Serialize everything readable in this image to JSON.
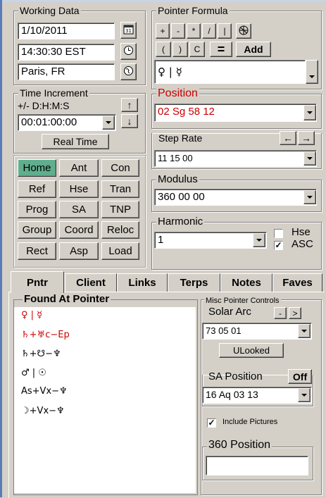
{
  "working_data": {
    "title": "Working Data",
    "date": "1/10/2011",
    "time": "14:30:30  EST",
    "place": "Paris, FR"
  },
  "time_increment": {
    "title": "Time Increment",
    "format_label": "+/- D:H:M:S",
    "value": "00:01:00:00",
    "real_time_label": "Real Time"
  },
  "nav_buttons": [
    {
      "label": "Home",
      "active": true
    },
    {
      "label": "Ant"
    },
    {
      "label": "Con"
    },
    {
      "label": "Ref"
    },
    {
      "label": "Hse"
    },
    {
      "label": "Tran"
    },
    {
      "label": "Prog"
    },
    {
      "label": "SA"
    },
    {
      "label": "TNP"
    },
    {
      "label": "Group"
    },
    {
      "label": "Coord"
    },
    {
      "label": "Reloc"
    },
    {
      "label": "Rect"
    },
    {
      "label": "Asp"
    },
    {
      "label": "Load"
    }
  ],
  "pointer_formula": {
    "title": "Pointer Formula",
    "ops_row1": [
      "+",
      "-",
      "*",
      "/",
      "|"
    ],
    "ops_row2": [
      "(",
      ")",
      "C",
      "="
    ],
    "add_label": "Add",
    "formula": "♀ | ☿"
  },
  "position": {
    "title": "Position",
    "value": "02 Sg 58 12"
  },
  "step_rate": {
    "title": "Step Rate",
    "value": "11 15 00",
    "left_arrow": "←",
    "right_arrow": "→"
  },
  "modulus": {
    "title": "Modulus",
    "value": "360 00 00"
  },
  "harmonic": {
    "title": "Harmonic",
    "value": "1",
    "hse_label": "Hse",
    "asc_label": "ASC",
    "hse_checked": false,
    "asc_checked": true
  },
  "tabs": [
    "Pntr",
    "Client",
    "Links",
    "Terps",
    "Notes",
    "Faves"
  ],
  "found_at_pointer": {
    "title": "Found At Pointer",
    "items": [
      "♀ | ☿",
      "♄+♅c−Ep",
      "♄+☋−♆",
      "♂ | ☉",
      "As+Vx−♆",
      "☽+Vx−♆"
    ]
  },
  "misc_controls": {
    "title": "Misc Pointer Controls",
    "solar_arc_title": "Solar Arc",
    "minus": "-",
    "plus": ">",
    "solar_arc_value": "73 05 01",
    "unlooked_label": "ULooked",
    "sa_position_title": "SA Position",
    "off_label": "Off",
    "sa_position_value": "16 Aq 03 13",
    "include_pictures_label": "Include Pictures",
    "include_pictures_checked": true,
    "pos360_title": "360 Position",
    "pos360_value": ""
  },
  "colors": {
    "accent_red": "#cc0000",
    "active_green": "#5fae8e"
  }
}
